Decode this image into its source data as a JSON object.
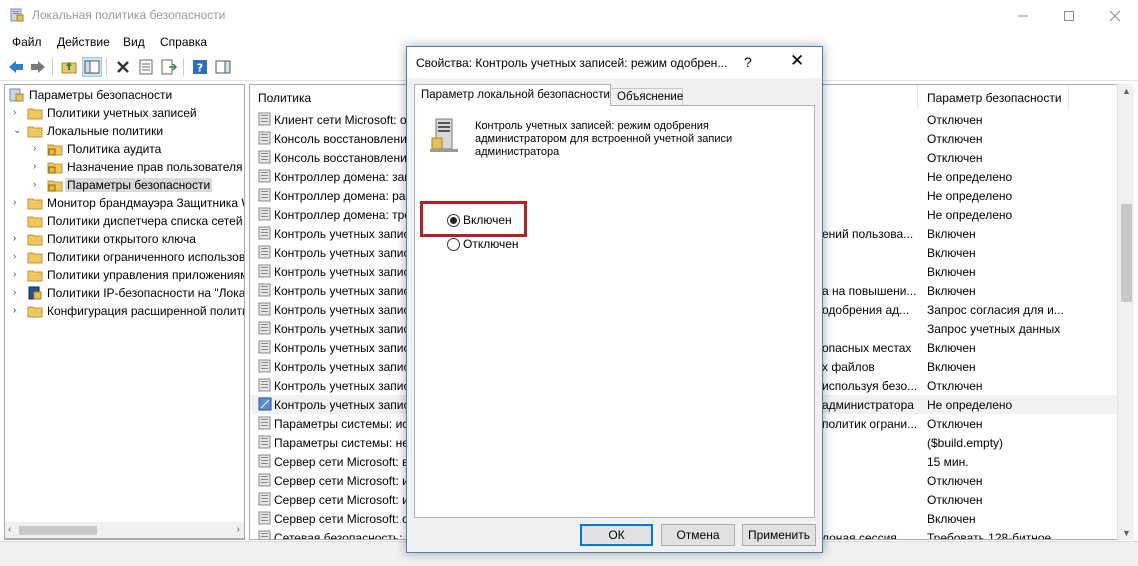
{
  "window": {
    "title": "Локальная политика безопасности",
    "minimize_icon": "minimize-icon",
    "maximize_icon": "maximize-icon",
    "close_icon": "close-icon"
  },
  "menu": [
    "Файл",
    "Действие",
    "Вид",
    "Справка"
  ],
  "tree": {
    "root": "Параметры безопасности",
    "items": [
      {
        "label": "Политики учетных записей",
        "level": 1,
        "expander": "›",
        "icon": "folder"
      },
      {
        "label": "Локальные политики",
        "level": 1,
        "expander": "⌄",
        "icon": "folder"
      },
      {
        "label": "Политика аудита",
        "level": 2,
        "expander": "›",
        "icon": "folder-lock"
      },
      {
        "label": "Назначение прав пользователя",
        "level": 2,
        "expander": "›",
        "icon": "folder-lock"
      },
      {
        "label": "Параметры безопасности",
        "level": 2,
        "expander": "›",
        "icon": "folder-lock",
        "selected": true
      },
      {
        "label": "Монитор брандмауэра Защитника Windows",
        "level": 1,
        "expander": "›",
        "icon": "folder"
      },
      {
        "label": "Политики диспетчера списка сетей",
        "level": 1,
        "expander": "",
        "icon": "folder"
      },
      {
        "label": "Политики открытого ключа",
        "level": 1,
        "expander": "›",
        "icon": "folder"
      },
      {
        "label": "Политики ограниченного использования программ",
        "level": 1,
        "expander": "›",
        "icon": "folder"
      },
      {
        "label": "Политики управления приложениями",
        "level": 1,
        "expander": "›",
        "icon": "folder"
      },
      {
        "label": "Политики IP-безопасности на \"Локальный компьютер\"",
        "level": 1,
        "expander": "›",
        "icon": "ipsec"
      },
      {
        "label": "Конфигурация расширенной политики аудита",
        "level": 1,
        "expander": "›",
        "icon": "folder"
      }
    ]
  },
  "list": {
    "col_policy": "Политика",
    "col_setting": "Параметр безопасности",
    "rows": [
      {
        "policy": "Клиент сети Microsoft: о",
        "mid": "",
        "value": "Отключен"
      },
      {
        "policy": "Консоль восстановлени",
        "mid": "",
        "value": "Отключен"
      },
      {
        "policy": "Консоль восстановлени",
        "mid": "",
        "value": "Отключен"
      },
      {
        "policy": "Контроллер домена: зап",
        "mid": "",
        "value": "Не определено"
      },
      {
        "policy": "Контроллер домена: раз",
        "mid": "",
        "value": "Не определено"
      },
      {
        "policy": "Контроллер домена: тре",
        "mid": "",
        "value": "Не определено"
      },
      {
        "policy": "Контроль учетных запис",
        "mid": "ений пользова...",
        "value": "Включен"
      },
      {
        "policy": "Контроль учетных запис",
        "mid": "",
        "value": "Включен"
      },
      {
        "policy": "Контроль учетных запис",
        "mid": "",
        "value": "Включен"
      },
      {
        "policy": "Контроль учетных запис",
        "mid": "а на повышени...",
        "value": "Включен"
      },
      {
        "policy": "Контроль учетных запис",
        "mid": "одобрения ад...",
        "value": "Запрос согласия для и..."
      },
      {
        "policy": "Контроль учетных запис",
        "mid": "",
        "value": "Запрос учетных данных"
      },
      {
        "policy": "Контроль учетных запис",
        "mid": "опасных местах",
        "value": "Включен"
      },
      {
        "policy": "Контроль учетных запис",
        "mid": "х файлов",
        "value": "Включен"
      },
      {
        "policy": "Контроль учетных запис",
        "mid": "используя безо...",
        "value": "Отключен"
      },
      {
        "policy": "Контроль учетных запис",
        "mid": "администратора",
        "value": "Не определено",
        "highlight": true
      },
      {
        "policy": "Параметры системы: ис",
        "mid": "политик ограни...",
        "value": "Отключен"
      },
      {
        "policy": "Параметры системы: не",
        "mid": "",
        "value": "($build.empty)"
      },
      {
        "policy": "Сервер сети Microsoft: в",
        "mid": "",
        "value": "15 мин."
      },
      {
        "policy": "Сервер сети Microsoft: и",
        "mid": "",
        "value": "Отключен"
      },
      {
        "policy": "Сервер сети Microsoft: и",
        "mid": "",
        "value": "Отключен"
      },
      {
        "policy": "Сервер сети Microsoft: о",
        "mid": "",
        "value": "Включен"
      },
      {
        "policy": "Сетевая безопасность: м",
        "mid": "лоная сессия...",
        "value": "Требовать 128-битное..."
      }
    ]
  },
  "dialog": {
    "title": "Свойства: Контроль учетных записей: режим одобрен...",
    "help": "?",
    "close": "✕",
    "tab_local": "Параметр локальной безопасности",
    "tab_explain": "Объяснение",
    "description": "Контроль учетных записей: режим одобрения администратором для встроенной учетной записи администратора",
    "radio_enabled": "Включен",
    "radio_disabled": "Отключен",
    "selected": "enabled",
    "btn_ok": "ОК",
    "btn_cancel": "Отмена",
    "btn_apply": "Применить"
  },
  "colors": {
    "highlight_border": "#b22222",
    "dialog_border": "#4a7fc1",
    "default_button": "#0078d7"
  }
}
